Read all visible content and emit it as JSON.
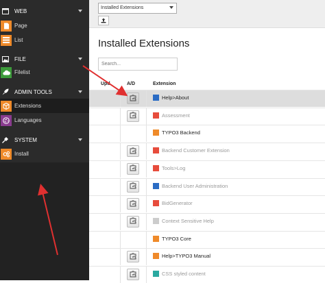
{
  "sidebar": {
    "sections": [
      {
        "label": "WEB",
        "icon": "web-icon",
        "items": [
          {
            "label": "Page",
            "icon": "page-module-icon",
            "color": "#ef8a2a"
          },
          {
            "label": "List",
            "icon": "list-module-icon",
            "color": "#ef8a2a"
          }
        ]
      },
      {
        "label": "FILE",
        "icon": "file-icon",
        "items": [
          {
            "label": "Filelist",
            "icon": "filelist-module-icon",
            "color": "#3d9b3b"
          }
        ]
      },
      {
        "label": "ADMIN TOOLS",
        "icon": "rocket-icon",
        "items": [
          {
            "label": "Extensions",
            "icon": "extensions-module-icon",
            "color": "#ef8a2a"
          },
          {
            "label": "Languages",
            "icon": "languages-module-icon",
            "color": "#8a3c8f"
          }
        ]
      },
      {
        "label": "SYSTEM",
        "icon": "plug-icon",
        "items": [
          {
            "label": "Install",
            "icon": "install-module-icon",
            "color": "#ef8a2a"
          }
        ]
      }
    ]
  },
  "docheader": {
    "function_select": "Installed Extensions",
    "upload_icon": "upload-icon"
  },
  "main": {
    "title": "Installed Extensions",
    "search_placeholder": "Search...",
    "columns": [
      "Upd.",
      "A/D",
      "Extension"
    ],
    "rows": [
      {
        "name": "Help>About",
        "icon_color": "#2b6cc4",
        "active": true,
        "has_ad": true,
        "highlight": true
      },
      {
        "name": "Assessment",
        "icon_color": "#e74c3c",
        "active": false,
        "has_ad": true
      },
      {
        "name": "TYPO3 Backend",
        "icon_color": "#ef8a2a",
        "active": true,
        "has_ad": false
      },
      {
        "name": "Backend Customer Extension",
        "icon_color": "#e74c3c",
        "active": false,
        "has_ad": true
      },
      {
        "name": "Tools>Log",
        "icon_color": "#e74c3c",
        "active": false,
        "has_ad": true
      },
      {
        "name": "Backend User Administration",
        "icon_color": "#2b6cc4",
        "active": false,
        "has_ad": true
      },
      {
        "name": "BidGenerator",
        "icon_color": "#e74c3c",
        "active": false,
        "has_ad": true
      },
      {
        "name": "Context Sensitive Help",
        "icon_color": "#cccccc",
        "active": false,
        "has_ad": true
      },
      {
        "name": "TYPO3 Core",
        "icon_color": "#ef8a2a",
        "active": true,
        "has_ad": false
      },
      {
        "name": "Help>TYPO3 Manual",
        "icon_color": "#ef8a2a",
        "active": true,
        "has_ad": true
      },
      {
        "name": "CSS styled content",
        "icon_color": "#2aa9a0",
        "active": false,
        "has_ad": true
      }
    ]
  },
  "colors": {
    "sidebar_bg": "#2b2b2b",
    "annotation_arrow": "#e03030"
  }
}
